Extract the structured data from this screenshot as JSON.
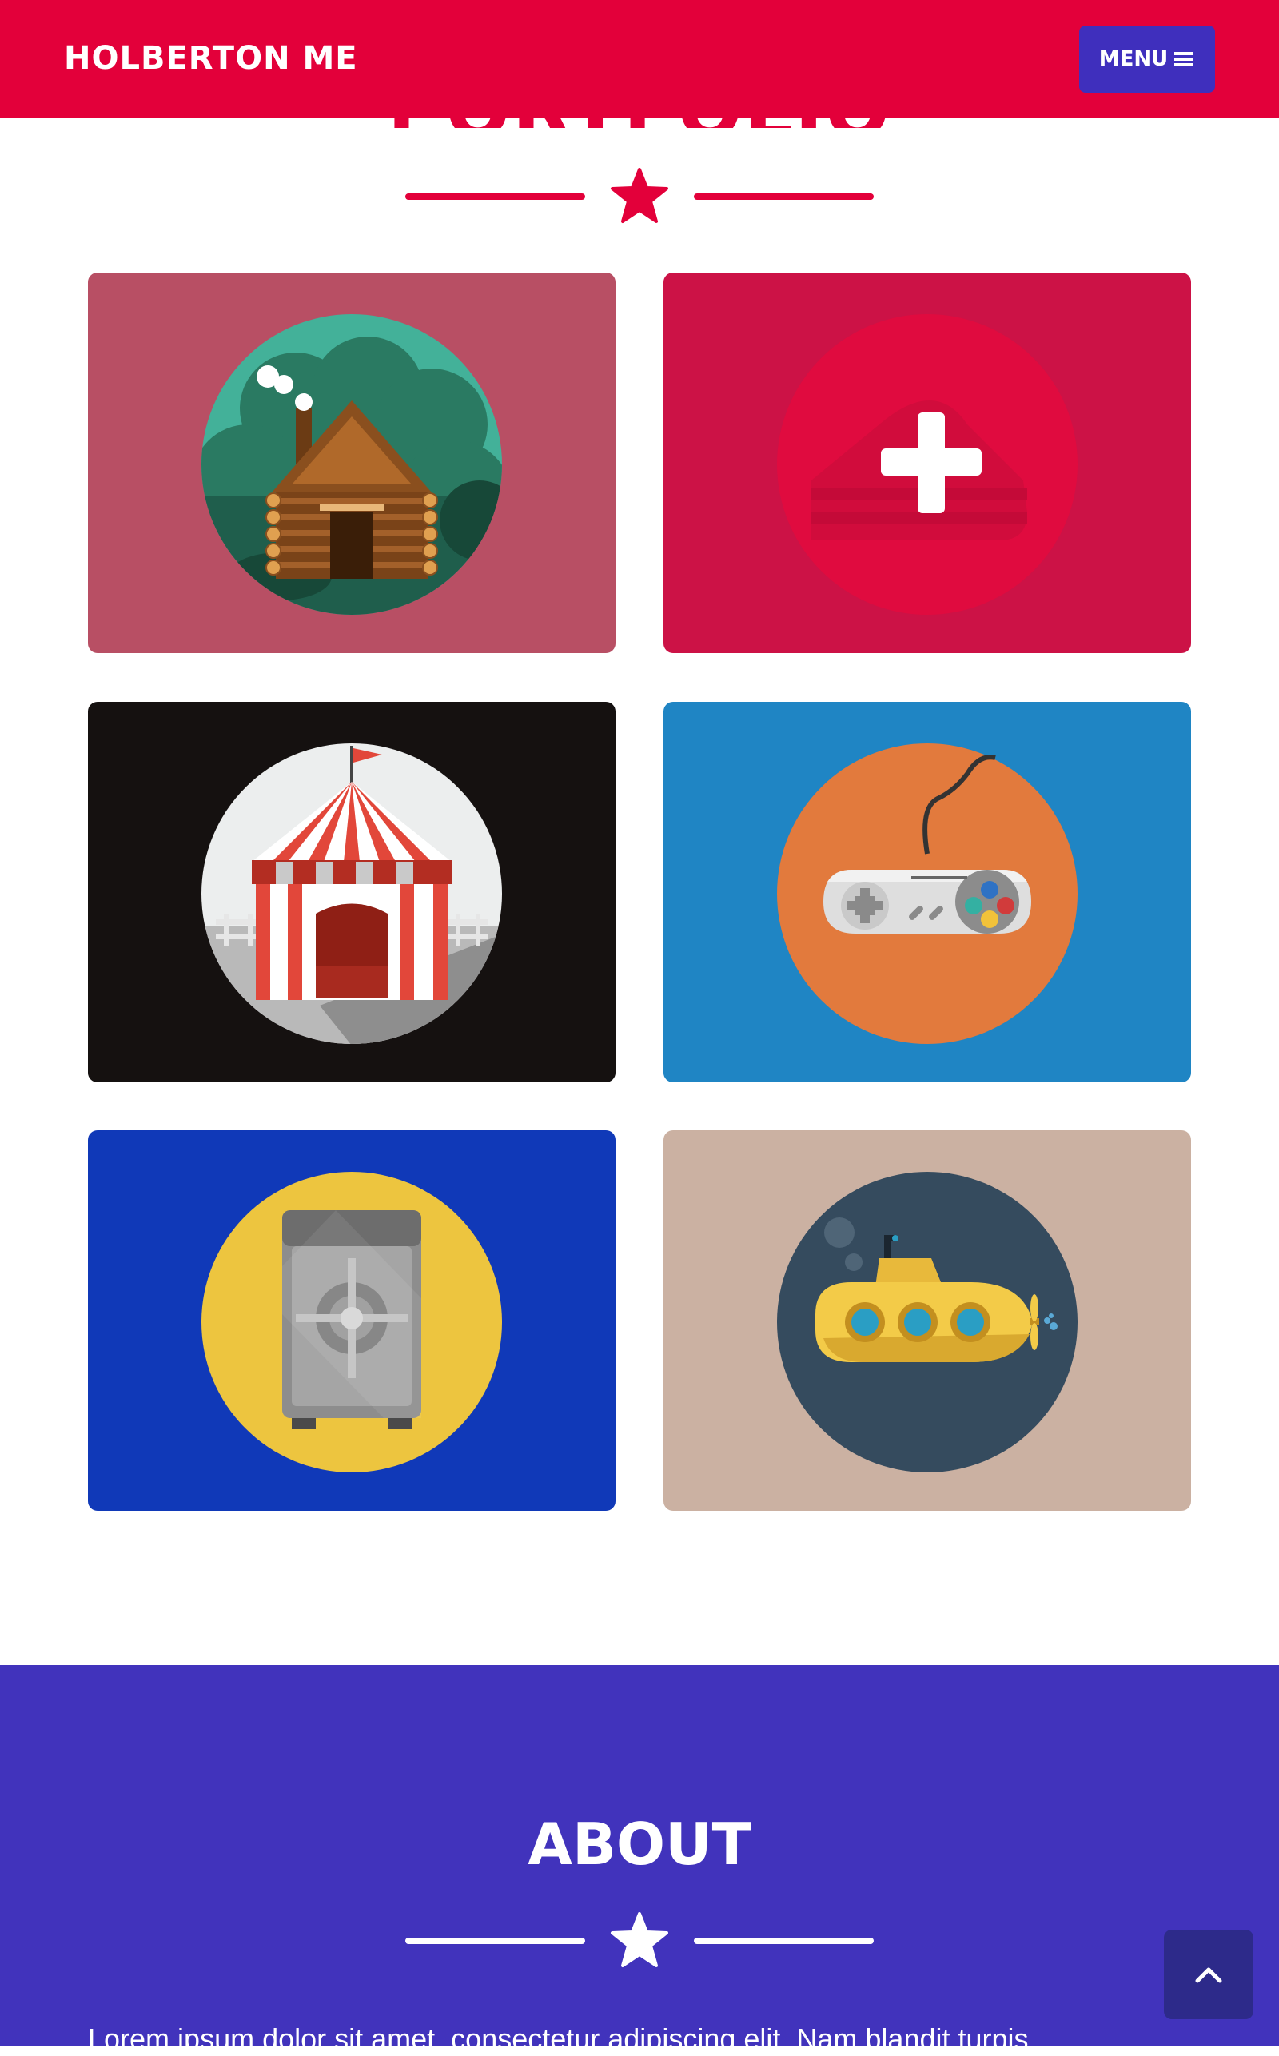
{
  "navbar": {
    "brand": "HOLBERTON ME",
    "menu_label": "MENU"
  },
  "portfolio": {
    "title": "PORTFOLIO",
    "cards": [
      {
        "illustration": "cabin-icon",
        "background": "#b84f64",
        "circle": "#43b199"
      },
      {
        "illustration": "cake-icon",
        "background": "#cc1246",
        "circle": "#e00b3f"
      },
      {
        "illustration": "circus-tent-icon",
        "background": "#151110",
        "circle": "#eceeee"
      },
      {
        "illustration": "game-controller-icon",
        "background": "#1f85c4",
        "circle": "#e27a3d"
      },
      {
        "illustration": "safe-icon",
        "background": "#1039b8",
        "circle": "#edc53f"
      },
      {
        "illustration": "submarine-icon",
        "background": "#cbb1a2",
        "circle": "#354b5e"
      }
    ]
  },
  "about": {
    "title": "ABOUT",
    "text": "Lorem ipsum dolor sit amet, consectetur adipiscing elit. Nam blandit turpis"
  },
  "colors": {
    "primary": "#e3003a",
    "secondary": "#4133bc",
    "white": "#ffffff"
  }
}
